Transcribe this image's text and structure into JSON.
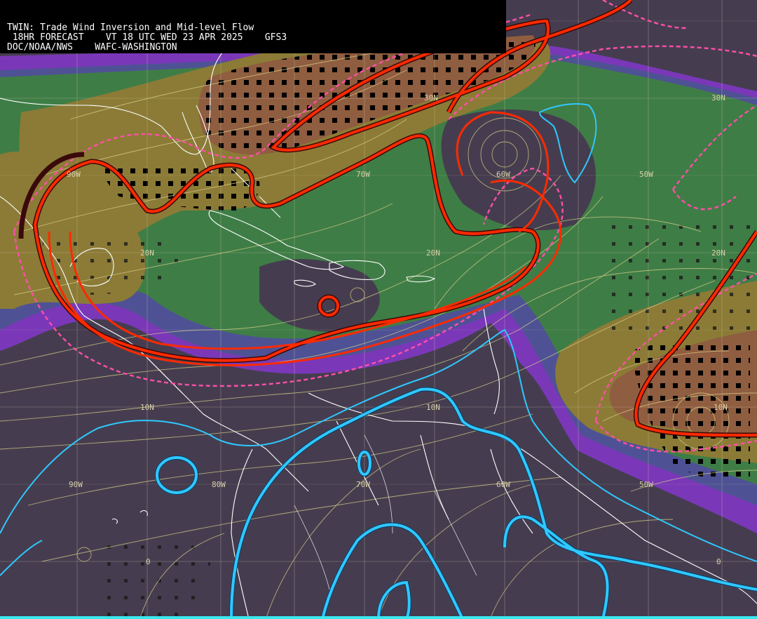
{
  "header": {
    "line1": "TWIN: Trade Wind Inversion and Mid-level Flow",
    "line2": " 18HR FORECAST    VT 18 UTC WED 23 APR 2025    GFS3",
    "line3": "DOC/NOAA/NWS    WAFC-WASHINGTON"
  },
  "grid_labels": {
    "lat_30n_mid": "30N",
    "lat_30n_right": "30N",
    "lon_90w_top": "90W",
    "lon_70w_top": "70W",
    "lon_60w_top": "60W",
    "lon_50w_top": "50W",
    "lat_20n_left": "20N",
    "lat_20n_mid": "20N",
    "lat_20n_right": "20N",
    "lat_10n_left": "10N",
    "lat_10n_mid": "10N",
    "lat_10n_right": "10N",
    "lon_90w_bottom": "90W",
    "lon_80w_bottom": "80W",
    "lon_70w_bottom": "70W",
    "lon_60w_bottom": "60W",
    "lon_50w_bottom": "50W",
    "eq_left": "0",
    "eq_right": "0"
  },
  "colors": {
    "background": "#453d4f",
    "purple": "#7a38b8",
    "slate": "#4e5294",
    "green": "#3f7d46",
    "olive": "#8b7b36",
    "brown": "#8f5d40",
    "inversion_contour": "#ff2a00",
    "dashed_contour": "#ff4fa8",
    "cyan_contour": "#2fc8ff",
    "streamline": "#d9cf8a",
    "coastline": "#ffffff"
  }
}
